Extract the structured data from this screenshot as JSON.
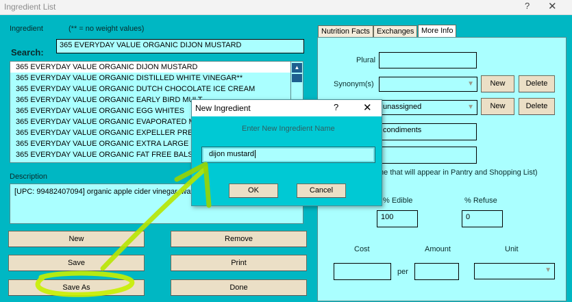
{
  "window": {
    "title": "Ingredient List",
    "help": "?",
    "close": "✕"
  },
  "left": {
    "ingredient_label": "Ingredient",
    "weight_note": "(** =  no weight values)",
    "search_label": "Search:",
    "search_value": "365 EVERYDAY VALUE ORGANIC DIJON MUSTARD",
    "list_items": [
      "365 EVERYDAY VALUE ORGANIC DIJON MUSTARD",
      "365 EVERYDAY VALUE ORGANIC DISTILLED WHITE VINEGAR**",
      "365 EVERYDAY VALUE ORGANIC DUTCH CHOCOLATE ICE CREAM",
      "365 EVERYDAY VALUE ORGANIC EARLY BIRD MULT",
      "365 EVERYDAY VALUE ORGANIC EGG WHITES",
      "365 EVERYDAY VALUE ORGANIC EVAPORATED MIL",
      "365 EVERYDAY VALUE ORGANIC EXPELLER PRESSE",
      "365 EVERYDAY VALUE ORGANIC EXTRA LARGE BR",
      "365 EVERYDAY VALUE ORGANIC FAT FREE BALSAM"
    ],
    "description_label": "Description",
    "description_value": "[UPC: 99482407094] organic apple cider vinegar, wat salt, organic spices.",
    "buttons": {
      "new": "New",
      "remove": "Remove",
      "save": "Save",
      "print": "Print",
      "save_as": "Save As",
      "done": "Done"
    }
  },
  "tabs": [
    {
      "label": "Nutrition Facts"
    },
    {
      "label": "Exchanges"
    },
    {
      "label": "More Info"
    }
  ],
  "info": {
    "plural_label": "Plural",
    "plural_value": "",
    "synonyms_label": "Synonym(s)",
    "synonyms_value": "",
    "category_value": "unassigned",
    "store_value": "condiments",
    "extra_value": "",
    "pantry_note": "me that will appear in Pantry and Shopping List)",
    "new_label": "New",
    "delete_label": "Delete",
    "edible_label": "% Edible",
    "edible_value": "100",
    "refuse_label": "% Refuse",
    "refuse_value": "0",
    "cost_label": "Cost",
    "amount_label": "Amount",
    "unit_label": "Unit",
    "per_label": "per"
  },
  "dialog": {
    "title": "New Ingredient",
    "help": "?",
    "close": "✕",
    "prompt": "Enter New Ingredient Name",
    "value": "dijon mustard",
    "ok": "OK",
    "cancel": "Cancel"
  },
  "colors": {
    "background": "#00b7c3",
    "field": "#aaffff",
    "button": "#ebdfc6",
    "annotation": "#c8f000"
  }
}
